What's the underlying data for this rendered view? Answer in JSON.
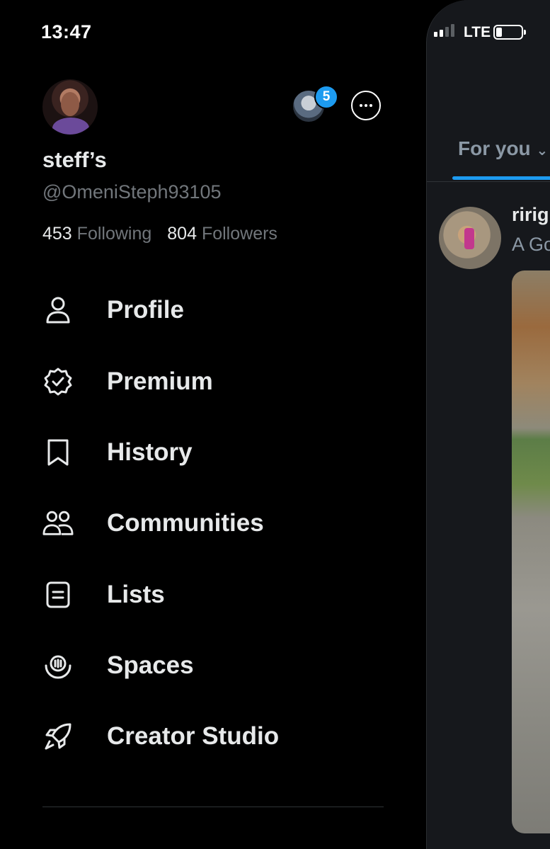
{
  "status_bar": {
    "time": "13:47",
    "network": "LTE"
  },
  "profile": {
    "display_name": "steff’s",
    "handle": "@OmeniSteph93105",
    "following_count": "453",
    "following_label": "Following",
    "followers_count": "804",
    "followers_label": "Followers"
  },
  "account_switcher": {
    "badge_count": "5"
  },
  "menu": {
    "items": [
      {
        "label": "Profile",
        "icon": "person-icon"
      },
      {
        "label": "Premium",
        "icon": "verified-badge-icon"
      },
      {
        "label": "History",
        "icon": "bookmark-icon"
      },
      {
        "label": "Communities",
        "icon": "people-icon"
      },
      {
        "label": "Lists",
        "icon": "list-icon"
      },
      {
        "label": "Spaces",
        "icon": "spaces-mic-icon"
      },
      {
        "label": "Creator Studio",
        "icon": "rocket-icon"
      }
    ]
  },
  "feed": {
    "tab_label": "For you",
    "post": {
      "author_partial": "ririg",
      "text_partial": "A Go"
    }
  },
  "colors": {
    "accent": "#1d9bf0",
    "background": "#000000",
    "text": "#e7e9ea",
    "muted": "#71767b"
  }
}
